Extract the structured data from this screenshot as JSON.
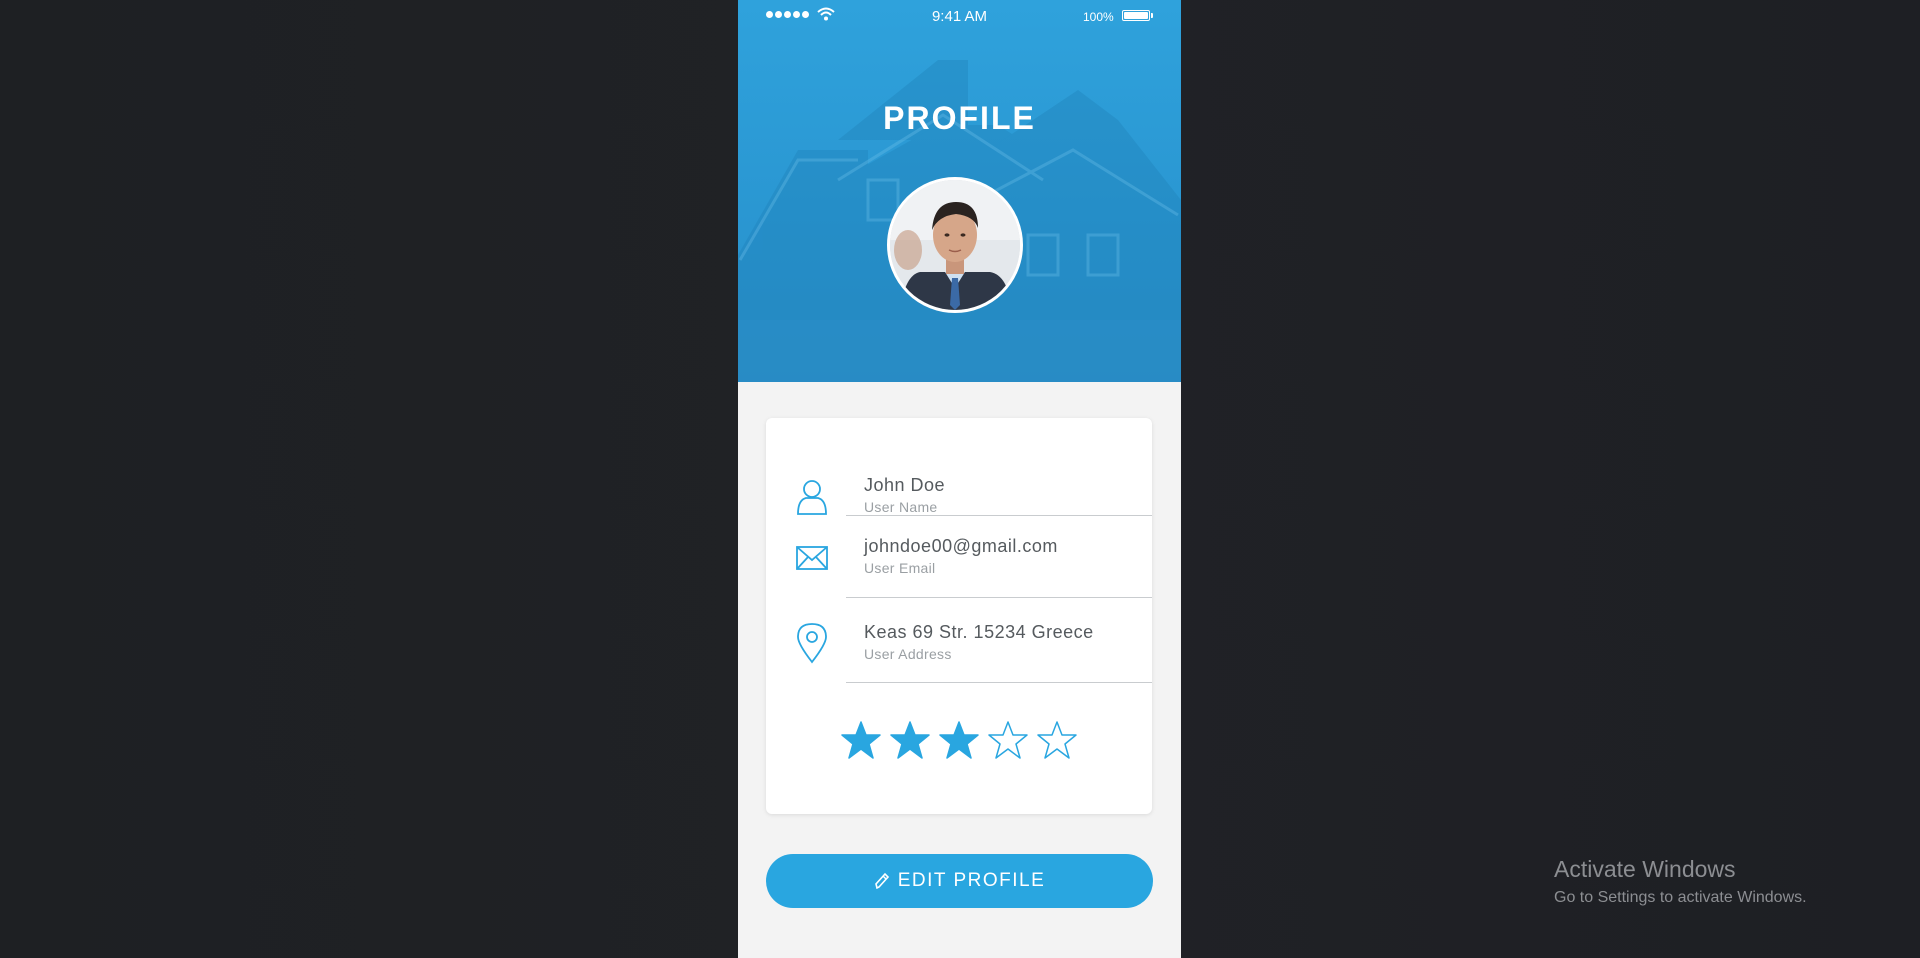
{
  "status_bar": {
    "time": "9:41 AM",
    "battery_percent": "100%",
    "signal_bars": 5
  },
  "header": {
    "title": "PROFILE"
  },
  "profile": {
    "fields": [
      {
        "icon": "user-icon",
        "value": "John Doe",
        "label": "User Name"
      },
      {
        "icon": "mail-icon",
        "value": "johndoe00@gmail.com",
        "label": "User Email"
      },
      {
        "icon": "location-pin-icon",
        "value": "Keas 69 Str. 15234 Greece",
        "label": "User Address"
      }
    ],
    "rating": 3,
    "rating_max": 5
  },
  "actions": {
    "edit_label": "EDIT PROFILE"
  },
  "watermark": {
    "title": "Activate Windows",
    "subtitle": "Go to Settings to activate Windows."
  },
  "colors": {
    "accent": "#29a6e0",
    "header_blue": "#2fa2dc",
    "background": "#1f2124",
    "card": "#ffffff"
  }
}
